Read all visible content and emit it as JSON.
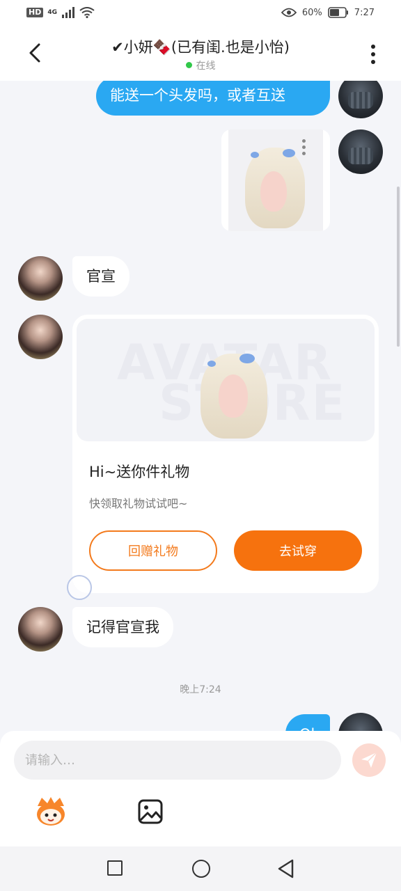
{
  "status_bar": {
    "network_label": "HD",
    "signal_label": "4G",
    "battery_text": "60%",
    "time": "7:27"
  },
  "header": {
    "title": "✔小妍🍫(已有闺.也是小怡)",
    "status": "在线"
  },
  "messages": [
    {
      "side": "me",
      "text": "能送一个头发吗，或者互送"
    },
    {
      "side": "me",
      "type": "image"
    },
    {
      "side": "other",
      "text": "官宣"
    },
    {
      "side": "other",
      "type": "gift_card"
    },
    {
      "side": "other",
      "text": "记得官宣我"
    },
    {
      "side": "me",
      "text": "Ok"
    }
  ],
  "gift_card": {
    "watermark_line1": "AVATAR",
    "watermark_line2": "STORE",
    "title": "Hi~送你件礼物",
    "subtitle": "快领取礼物试试吧~",
    "return_button": "回赠礼物",
    "try_button": "去试穿"
  },
  "timestamp": "晚上7:24",
  "input": {
    "placeholder": "请输入…",
    "value": ""
  },
  "toolbar": {
    "emoji_icon": "mascot-sticker-icon",
    "image_icon": "image-icon",
    "send_icon": "send-icon"
  },
  "colors": {
    "my_bubble": "#2aa8f2",
    "accent_orange": "#f6720e",
    "online_green": "#31c84a"
  }
}
